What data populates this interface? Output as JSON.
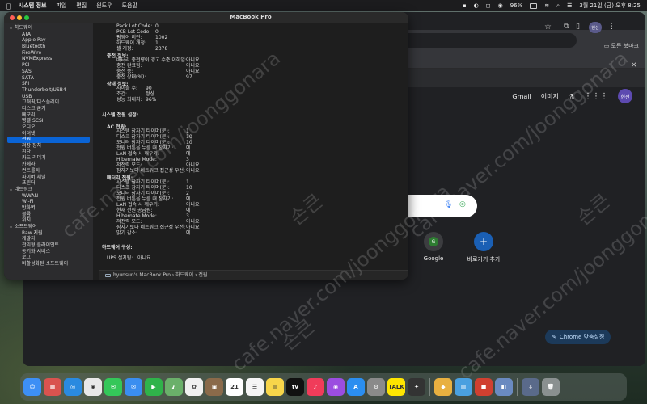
{
  "menubar": {
    "app_name": "시스템 정보",
    "menus": [
      "파일",
      "편집",
      "윈도우",
      "도움말"
    ],
    "battery": "96%",
    "clock": "3월 21일 (금) 오후 8:25"
  },
  "chrome": {
    "bookmark_folder": "모든 북마크",
    "banner_close": "×",
    "profile_chip": "현선",
    "gmail": "Gmail",
    "images": "이미지",
    "avatar": "현선",
    "shortcuts": [
      {
        "label": "Google",
        "glyph": "G"
      },
      {
        "label": "바로가기 추가",
        "glyph": "+"
      }
    ],
    "customize_label": "Chrome 맞춤설정"
  },
  "sysinfo": {
    "window_title": "MacBook Pro",
    "sidebar": [
      {
        "label": "하드웨어",
        "group": true
      },
      {
        "label": "ATA"
      },
      {
        "label": "Apple Pay"
      },
      {
        "label": "Bluetooth"
      },
      {
        "label": "FireWire"
      },
      {
        "label": "NVMExpress"
      },
      {
        "label": "PCI"
      },
      {
        "label": "SAS"
      },
      {
        "label": "SATA"
      },
      {
        "label": "SPI"
      },
      {
        "label": "Thunderbolt/USB4"
      },
      {
        "label": "USB"
      },
      {
        "label": "그래픽/디스플레이"
      },
      {
        "label": "디스크 굽기"
      },
      {
        "label": "메모리"
      },
      {
        "label": "병렬 SCSI"
      },
      {
        "label": "오디오"
      },
      {
        "label": "이더넷"
      },
      {
        "label": "전원",
        "selected": true
      },
      {
        "label": "저장 장치"
      },
      {
        "label": "진단"
      },
      {
        "label": "카드 리더기"
      },
      {
        "label": "카메라"
      },
      {
        "label": "컨트롤러"
      },
      {
        "label": "파이버 채널"
      },
      {
        "label": "프린터"
      },
      {
        "label": "네트워크",
        "group": true
      },
      {
        "label": "WWAN"
      },
      {
        "label": "Wi-Fi"
      },
      {
        "label": "방화벽"
      },
      {
        "label": "볼륨"
      },
      {
        "label": "위치"
      },
      {
        "label": "소프트웨어",
        "group": true
      },
      {
        "label": "Raw 지원"
      },
      {
        "label": "개발자"
      },
      {
        "label": "관리형 클라이언트"
      },
      {
        "label": "동기화 서비스"
      },
      {
        "label": "로그"
      },
      {
        "label": "비활성화된 소프트웨어"
      }
    ],
    "content": {
      "battery_info_top": [
        {
          "k": "Pack Lot Code:",
          "v": "0"
        },
        {
          "k": "PCB Lot Code:",
          "v": "0"
        },
        {
          "k": "펌웨어 버전:",
          "v": "1002"
        },
        {
          "k": "하드웨어 개정:",
          "v": "1"
        },
        {
          "k": "셀 개정:",
          "v": "2378"
        }
      ],
      "charge_title": "충전 정보:",
      "charge": [
        {
          "k": "배터리 충전량이 경고 수준 이하임:",
          "v": "아니요"
        },
        {
          "k": "충전 완료됨:",
          "v": "아니요"
        },
        {
          "k": "충전 중:",
          "v": "아니요"
        },
        {
          "k": "충전 상태(%):",
          "v": "97"
        }
      ],
      "health_title": "상태 정보:",
      "health": [
        {
          "k": "사이클 수:",
          "v": "90"
        },
        {
          "k": "조건:",
          "v": "정상"
        },
        {
          "k": "성능 최대치:",
          "v": "96%"
        }
      ],
      "power_settings_title": "시스템 전원 설정:",
      "ac_title": "AC 전원:",
      "ac": [
        {
          "k": "시스템 잠자기 타이머(분):",
          "v": "1"
        },
        {
          "k": "디스크 잠자기 타이머(분):",
          "v": "10"
        },
        {
          "k": "모니터 잠자기 타이머(분):",
          "v": "10"
        },
        {
          "k": "전원 버튼을 누를 때 잠자기:",
          "v": "예"
        },
        {
          "k": "LAN 접속 시 깨우기:",
          "v": "예"
        },
        {
          "k": "Hibernate Mode:",
          "v": "3"
        },
        {
          "k": "저전력 모드:",
          "v": "아니요"
        },
        {
          "k": "잠자기보다 네트워크 접근성 우선:",
          "v": "아니요"
        }
      ],
      "battery_power_title": "배터리 전원:",
      "battery_power": [
        {
          "k": "시스템 잠자기 타이머(분):",
          "v": "1"
        },
        {
          "k": "디스크 잠자기 타이머(분):",
          "v": "10"
        },
        {
          "k": "모니터 잠자기 타이머(분):",
          "v": "2"
        },
        {
          "k": "전원 버튼을 누를 때 잠자기:",
          "v": "예"
        },
        {
          "k": "LAN 접속 시 깨우기:",
          "v": "아니요"
        },
        {
          "k": "현재 전원 공급원:",
          "v": "예"
        },
        {
          "k": "Hibernate Mode:",
          "v": "3"
        },
        {
          "k": "저전력 모드:",
          "v": "아니요"
        },
        {
          "k": "잠자기보다 네트워크 접근성 우선:",
          "v": "아니요"
        },
        {
          "k": "밝기 감소:",
          "v": "예"
        }
      ],
      "hw_config_title": "하드웨어 구성:",
      "ups": {
        "k": "UPS 설치됨:",
        "v": "아니요"
      }
    },
    "breadcrumb": "hyunsun's MacBook Pro  ›  하드웨어  ›  전원"
  },
  "watermarks": {
    "site": "cafe.naver.com/joonggonara",
    "mark": "손큰"
  },
  "dock": {
    "apps": [
      {
        "name": "finder",
        "color": "#3d8ff5",
        "glyph": "☺"
      },
      {
        "name": "launchpad",
        "color": "#d9534f",
        "glyph": "▦"
      },
      {
        "name": "safari",
        "color": "#2a8ae0",
        "glyph": "◎"
      },
      {
        "name": "chrome",
        "color": "#e8e8e8",
        "glyph": "◉"
      },
      {
        "name": "messages",
        "color": "#34c759",
        "glyph": "✉"
      },
      {
        "name": "mail",
        "color": "#3a8ef0",
        "glyph": "✉"
      },
      {
        "name": "facetime",
        "color": "#2fb34a",
        "glyph": "▶"
      },
      {
        "name": "maps",
        "color": "#6ab06a",
        "glyph": "◭"
      },
      {
        "name": "photos",
        "color": "#f0f0f0",
        "glyph": "✿"
      },
      {
        "name": "notes-app",
        "color": "#8a6a4a",
        "glyph": "▣"
      },
      {
        "name": "calendar",
        "color": "#ffffff",
        "glyph": "21"
      },
      {
        "name": "reminders",
        "color": "#f5f5f5",
        "glyph": "☰"
      },
      {
        "name": "notes",
        "color": "#f7d54a",
        "glyph": "▤"
      },
      {
        "name": "tv",
        "color": "#111111",
        "glyph": "tv"
      },
      {
        "name": "music",
        "color": "#f03c5a",
        "glyph": "♪"
      },
      {
        "name": "podcasts",
        "color": "#9b4de0",
        "glyph": "◉"
      },
      {
        "name": "app-store",
        "color": "#2b8ef0",
        "glyph": "A"
      },
      {
        "name": "system-settings",
        "color": "#8a8a8a",
        "glyph": "⚙"
      },
      {
        "name": "kakaotalk",
        "color": "#fee500",
        "glyph": "TALK"
      },
      {
        "name": "final-cut",
        "color": "#333333",
        "glyph": "✦"
      },
      {
        "name": "sep"
      },
      {
        "name": "app-a",
        "color": "#e8b040",
        "glyph": "◆"
      },
      {
        "name": "app-b",
        "color": "#4aa0e0",
        "glyph": "▥"
      },
      {
        "name": "app-c",
        "color": "#d04030",
        "glyph": "■"
      },
      {
        "name": "preview",
        "color": "#6a8ac0",
        "glyph": "◧"
      },
      {
        "name": "sep"
      },
      {
        "name": "downloads",
        "color": "#5a6a8a",
        "glyph": "⇩"
      },
      {
        "name": "trash",
        "color": "#8a9090",
        "glyph": "🗑"
      }
    ]
  }
}
